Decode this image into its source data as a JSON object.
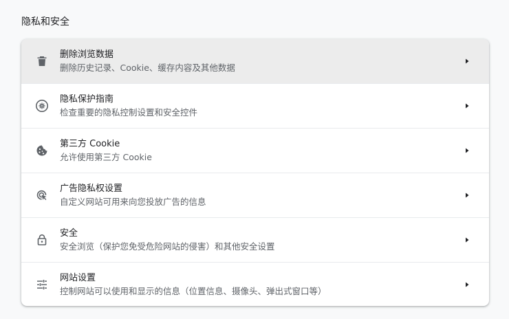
{
  "section": {
    "title": "隐私和安全"
  },
  "items": [
    {
      "title": "删除浏览数据",
      "subtitle": "删除历史记录、Cookie、缓存内容及其他数据",
      "icon": "trash-icon"
    },
    {
      "title": "隐私保护指南",
      "subtitle": "检查重要的隐私控制设置和安全控件",
      "icon": "privacy-guide-icon"
    },
    {
      "title": "第三方 Cookie",
      "subtitle": "允许使用第三方 Cookie",
      "icon": "cookie-icon"
    },
    {
      "title": "广告隐私权设置",
      "subtitle": "自定义网站可用来向您投放广告的信息",
      "icon": "ad-privacy-icon"
    },
    {
      "title": "安全",
      "subtitle": "安全浏览（保护您免受危险网站的侵害）和其他安全设置",
      "icon": "lock-icon"
    },
    {
      "title": "网站设置",
      "subtitle": "控制网站可以使用和显示的信息（位置信息、摄像头、弹出式窗口等）",
      "icon": "tune-icon"
    }
  ],
  "colors": {
    "background": "#f8f9fa",
    "card": "#ffffff",
    "hover_row": "#ececec",
    "icon": "#5f6368",
    "text_primary": "#202124",
    "text_secondary": "#5f6368"
  }
}
